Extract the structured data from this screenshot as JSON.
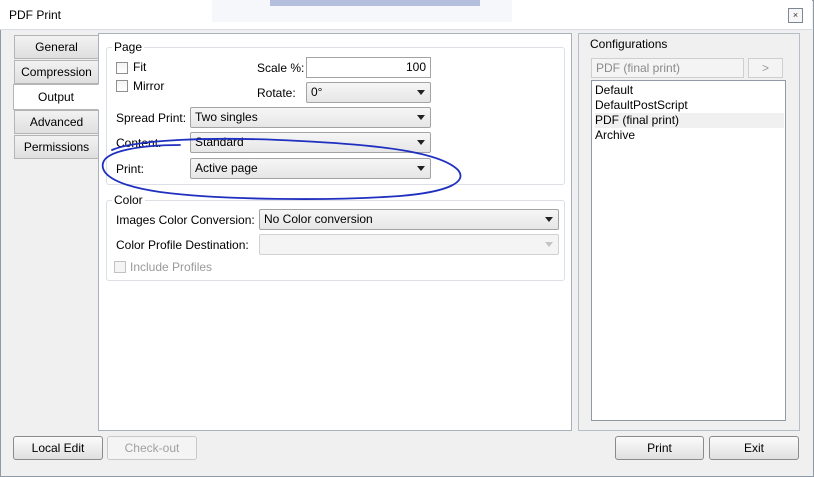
{
  "window": {
    "title": "PDF Print",
    "close_glyph": "×"
  },
  "tabs": [
    {
      "label": "General",
      "active": false
    },
    {
      "label": "Compression",
      "active": false
    },
    {
      "label": "Output",
      "active": true
    },
    {
      "label": "Advanced",
      "active": false
    },
    {
      "label": "Permissions",
      "active": false
    }
  ],
  "page_group": {
    "legend": "Page",
    "fit_label": "Fit",
    "fit_checked": false,
    "mirror_label": "Mirror",
    "mirror_checked": false,
    "scale_label": "Scale %:",
    "scale_value": "100",
    "rotate_label": "Rotate:",
    "rotate_value": "0°",
    "spread_label": "Spread Print:",
    "spread_value": "Two singles",
    "content_label": "Content:",
    "content_value": "Standard",
    "print_label": "Print:",
    "print_value": "Active page"
  },
  "color_group": {
    "legend": "Color",
    "images_conversion_label": "Images Color Conversion:",
    "images_conversion_value": "No Color conversion",
    "profile_dest_label": "Color Profile Destination:",
    "profile_dest_value": "",
    "include_profiles_label": "Include Profiles",
    "include_profiles_checked": false
  },
  "configurations": {
    "title": "Configurations",
    "name_value": "PDF (final print)",
    "go_label": ">",
    "items": [
      {
        "label": "Default",
        "selected": false
      },
      {
        "label": "DefaultPostScript",
        "selected": false
      },
      {
        "label": "PDF (final print)",
        "selected": true
      },
      {
        "label": "Archive",
        "selected": false
      }
    ]
  },
  "buttons": {
    "local_edit": "Local Edit",
    "check_out": "Check-out",
    "print": "Print",
    "exit": "Exit"
  },
  "annotation_color": "#1f2fbf"
}
